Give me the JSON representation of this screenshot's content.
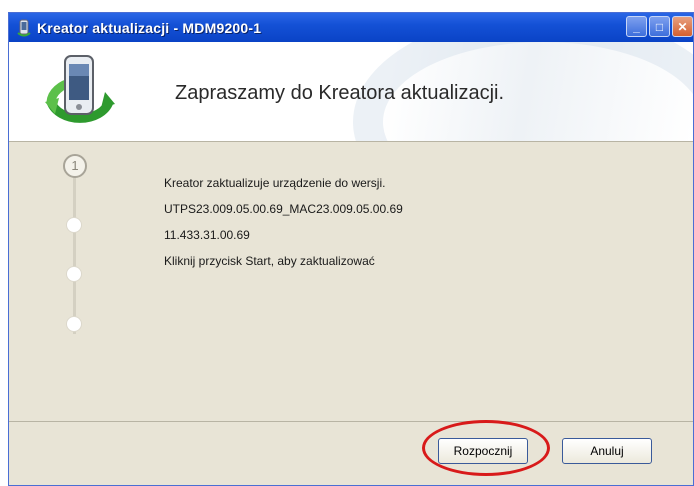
{
  "window": {
    "title": "Kreator aktualizacji - MDM9200-1",
    "title_icon": "phone-icon",
    "controls": [
      "minimize-icon",
      "maximize-icon",
      "close-icon"
    ]
  },
  "header": {
    "title": "Zapraszamy do Kreatora aktualizacji.",
    "logo_icon": "phone-sync-icon"
  },
  "steps": {
    "current": "1",
    "total_markers": 4
  },
  "content": {
    "lines": [
      "Kreator zaktualizuje urządzenie do wersji.",
      "UTPS23.009.05.00.69_MAC23.009.05.00.69",
      "11.433.31.00.69",
      "Kliknij przycisk Start, aby zaktualizować"
    ]
  },
  "buttons": {
    "start": "Rozpocznij",
    "cancel": "Anuluj"
  },
  "colors": {
    "titlebar": "#0a43c6",
    "panel": "#e8e4d6",
    "highlight": "#d81a1a"
  }
}
